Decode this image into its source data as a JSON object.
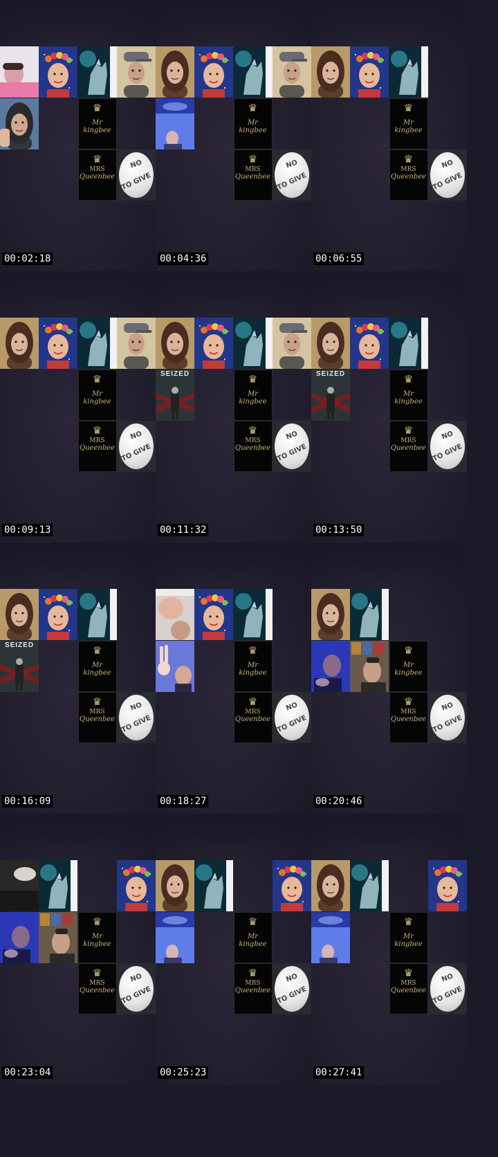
{
  "frames": [
    {
      "timestamp": "00:02:18",
      "tiles": [
        [
          0,
          0,
          "pink-person-camera"
        ],
        [
          1,
          0,
          "flower-crown-woman-portrait"
        ],
        [
          2,
          0,
          "wolf-moon-image"
        ],
        [
          3,
          0,
          "man-with-cap-camera"
        ],
        [
          0,
          1,
          "man-thumbs-up-camera"
        ],
        [
          2,
          1,
          "mr-kingbee-logo"
        ],
        [
          2,
          2,
          "mrs-queenbee-logo"
        ],
        [
          3,
          2,
          "no-to-give-button"
        ]
      ]
    },
    {
      "timestamp": "00:04:36",
      "tiles": [
        [
          0,
          0,
          "woman-long-hair-camera"
        ],
        [
          1,
          0,
          "flower-crown-woman-portrait"
        ],
        [
          2,
          0,
          "wolf-moon-image"
        ],
        [
          3,
          0,
          "man-with-cap-camera"
        ],
        [
          0,
          1,
          "blue-light-person-camera"
        ],
        [
          2,
          1,
          "mr-kingbee-logo"
        ],
        [
          2,
          2,
          "mrs-queenbee-logo"
        ],
        [
          3,
          2,
          "no-to-give-button"
        ]
      ]
    },
    {
      "timestamp": "00:06:55",
      "tiles": [
        [
          0,
          0,
          "woman-long-hair-camera"
        ],
        [
          1,
          0,
          "flower-crown-woman-portrait"
        ],
        [
          2,
          0,
          "wolf-moon-image"
        ],
        [
          2,
          1,
          "mr-kingbee-logo"
        ],
        [
          2,
          2,
          "mrs-queenbee-logo"
        ],
        [
          3,
          2,
          "no-to-give-button"
        ]
      ]
    },
    {
      "timestamp": "00:09:13",
      "tiles": [
        [
          0,
          0,
          "woman-long-hair-camera"
        ],
        [
          1,
          0,
          "flower-crown-woman-portrait"
        ],
        [
          2,
          0,
          "wolf-moon-image"
        ],
        [
          3,
          0,
          "man-with-cap-camera"
        ],
        [
          2,
          1,
          "mr-kingbee-logo"
        ],
        [
          2,
          2,
          "mrs-queenbee-logo"
        ],
        [
          3,
          2,
          "no-to-give-button"
        ]
      ]
    },
    {
      "timestamp": "00:11:32",
      "tiles": [
        [
          0,
          0,
          "woman-long-hair-camera"
        ],
        [
          1,
          0,
          "flower-crown-woman-portrait"
        ],
        [
          2,
          0,
          "wolf-moon-image"
        ],
        [
          3,
          0,
          "man-with-cap-camera"
        ],
        [
          0,
          1,
          "seized-poster"
        ],
        [
          2,
          1,
          "mr-kingbee-logo"
        ],
        [
          2,
          2,
          "mrs-queenbee-logo"
        ],
        [
          3,
          2,
          "no-to-give-button"
        ]
      ]
    },
    {
      "timestamp": "00:13:50",
      "tiles": [
        [
          0,
          0,
          "woman-long-hair-camera"
        ],
        [
          1,
          0,
          "flower-crown-woman-portrait"
        ],
        [
          2,
          0,
          "wolf-moon-image"
        ],
        [
          0,
          1,
          "seized-poster"
        ],
        [
          2,
          1,
          "mr-kingbee-logo"
        ],
        [
          2,
          2,
          "mrs-queenbee-logo"
        ],
        [
          3,
          2,
          "no-to-give-button"
        ]
      ]
    },
    {
      "timestamp": "00:16:09",
      "tiles": [
        [
          0,
          0,
          "woman-long-hair-camera"
        ],
        [
          1,
          0,
          "flower-crown-woman-portrait"
        ],
        [
          2,
          0,
          "wolf-moon-image"
        ],
        [
          0,
          1,
          "seized-poster"
        ],
        [
          2,
          1,
          "mr-kingbee-logo"
        ],
        [
          2,
          2,
          "mrs-queenbee-logo"
        ],
        [
          3,
          2,
          "no-to-give-button"
        ]
      ]
    },
    {
      "timestamp": "00:18:27",
      "tiles": [
        [
          0,
          0,
          "hand-wave-camera"
        ],
        [
          1,
          0,
          "flower-crown-woman-portrait"
        ],
        [
          2,
          0,
          "wolf-moon-image"
        ],
        [
          0,
          1,
          "peace-sign-man-camera"
        ],
        [
          2,
          1,
          "mr-kingbee-logo"
        ],
        [
          2,
          2,
          "mrs-queenbee-logo"
        ],
        [
          3,
          2,
          "no-to-give-button"
        ]
      ]
    },
    {
      "timestamp": "00:20:46",
      "tiles": [
        [
          0,
          0,
          "woman-long-hair-camera"
        ],
        [
          1,
          0,
          "wolf-moon-image"
        ],
        [
          0,
          1,
          "blue-man-camera"
        ],
        [
          1,
          1,
          "man-posters-background-camera"
        ],
        [
          2,
          1,
          "mr-kingbee-logo"
        ],
        [
          2,
          2,
          "mrs-queenbee-logo"
        ],
        [
          3,
          2,
          "no-to-give-button"
        ]
      ]
    },
    {
      "timestamp": "00:23:04",
      "tiles": [
        [
          0,
          0,
          "dark-room-camera"
        ],
        [
          1,
          0,
          "wolf-moon-image"
        ],
        [
          3,
          0,
          "flower-crown-woman-portrait"
        ],
        [
          0,
          1,
          "blue-man-camera"
        ],
        [
          1,
          1,
          "man-posters-background-camera"
        ],
        [
          2,
          1,
          "mr-kingbee-logo"
        ],
        [
          2,
          2,
          "mrs-queenbee-logo"
        ],
        [
          3,
          2,
          "no-to-give-button"
        ]
      ]
    },
    {
      "timestamp": "00:25:23",
      "tiles": [
        [
          0,
          0,
          "woman-long-hair-camera"
        ],
        [
          1,
          0,
          "wolf-moon-image"
        ],
        [
          3,
          0,
          "flower-crown-woman-portrait"
        ],
        [
          0,
          1,
          "blue-light-person-camera"
        ],
        [
          2,
          1,
          "mr-kingbee-logo"
        ],
        [
          2,
          2,
          "mrs-queenbee-logo"
        ],
        [
          3,
          2,
          "no-to-give-button"
        ]
      ]
    },
    {
      "timestamp": "00:27:41",
      "tiles": [
        [
          0,
          0,
          "woman-long-hair-camera"
        ],
        [
          1,
          0,
          "wolf-moon-image"
        ],
        [
          3,
          0,
          "flower-crown-woman-portrait"
        ],
        [
          0,
          1,
          "blue-light-person-camera"
        ],
        [
          2,
          1,
          "mr-kingbee-logo"
        ],
        [
          2,
          2,
          "mrs-queenbee-logo"
        ],
        [
          3,
          2,
          "no-to-give-button"
        ]
      ]
    }
  ],
  "logos": {
    "kingbee": "Mr kingbee",
    "queenbee_line1": "MRS",
    "queenbee_line2": "Queenbee",
    "give_line1": "NO",
    "give_line2": "TO GIVE",
    "seized": "SEIZED"
  },
  "colors": {
    "background": "#1b1a28",
    "timestamp_bg": "#000000",
    "timestamp_text": "#ffffff",
    "logo_gold": "#c9b27a"
  }
}
